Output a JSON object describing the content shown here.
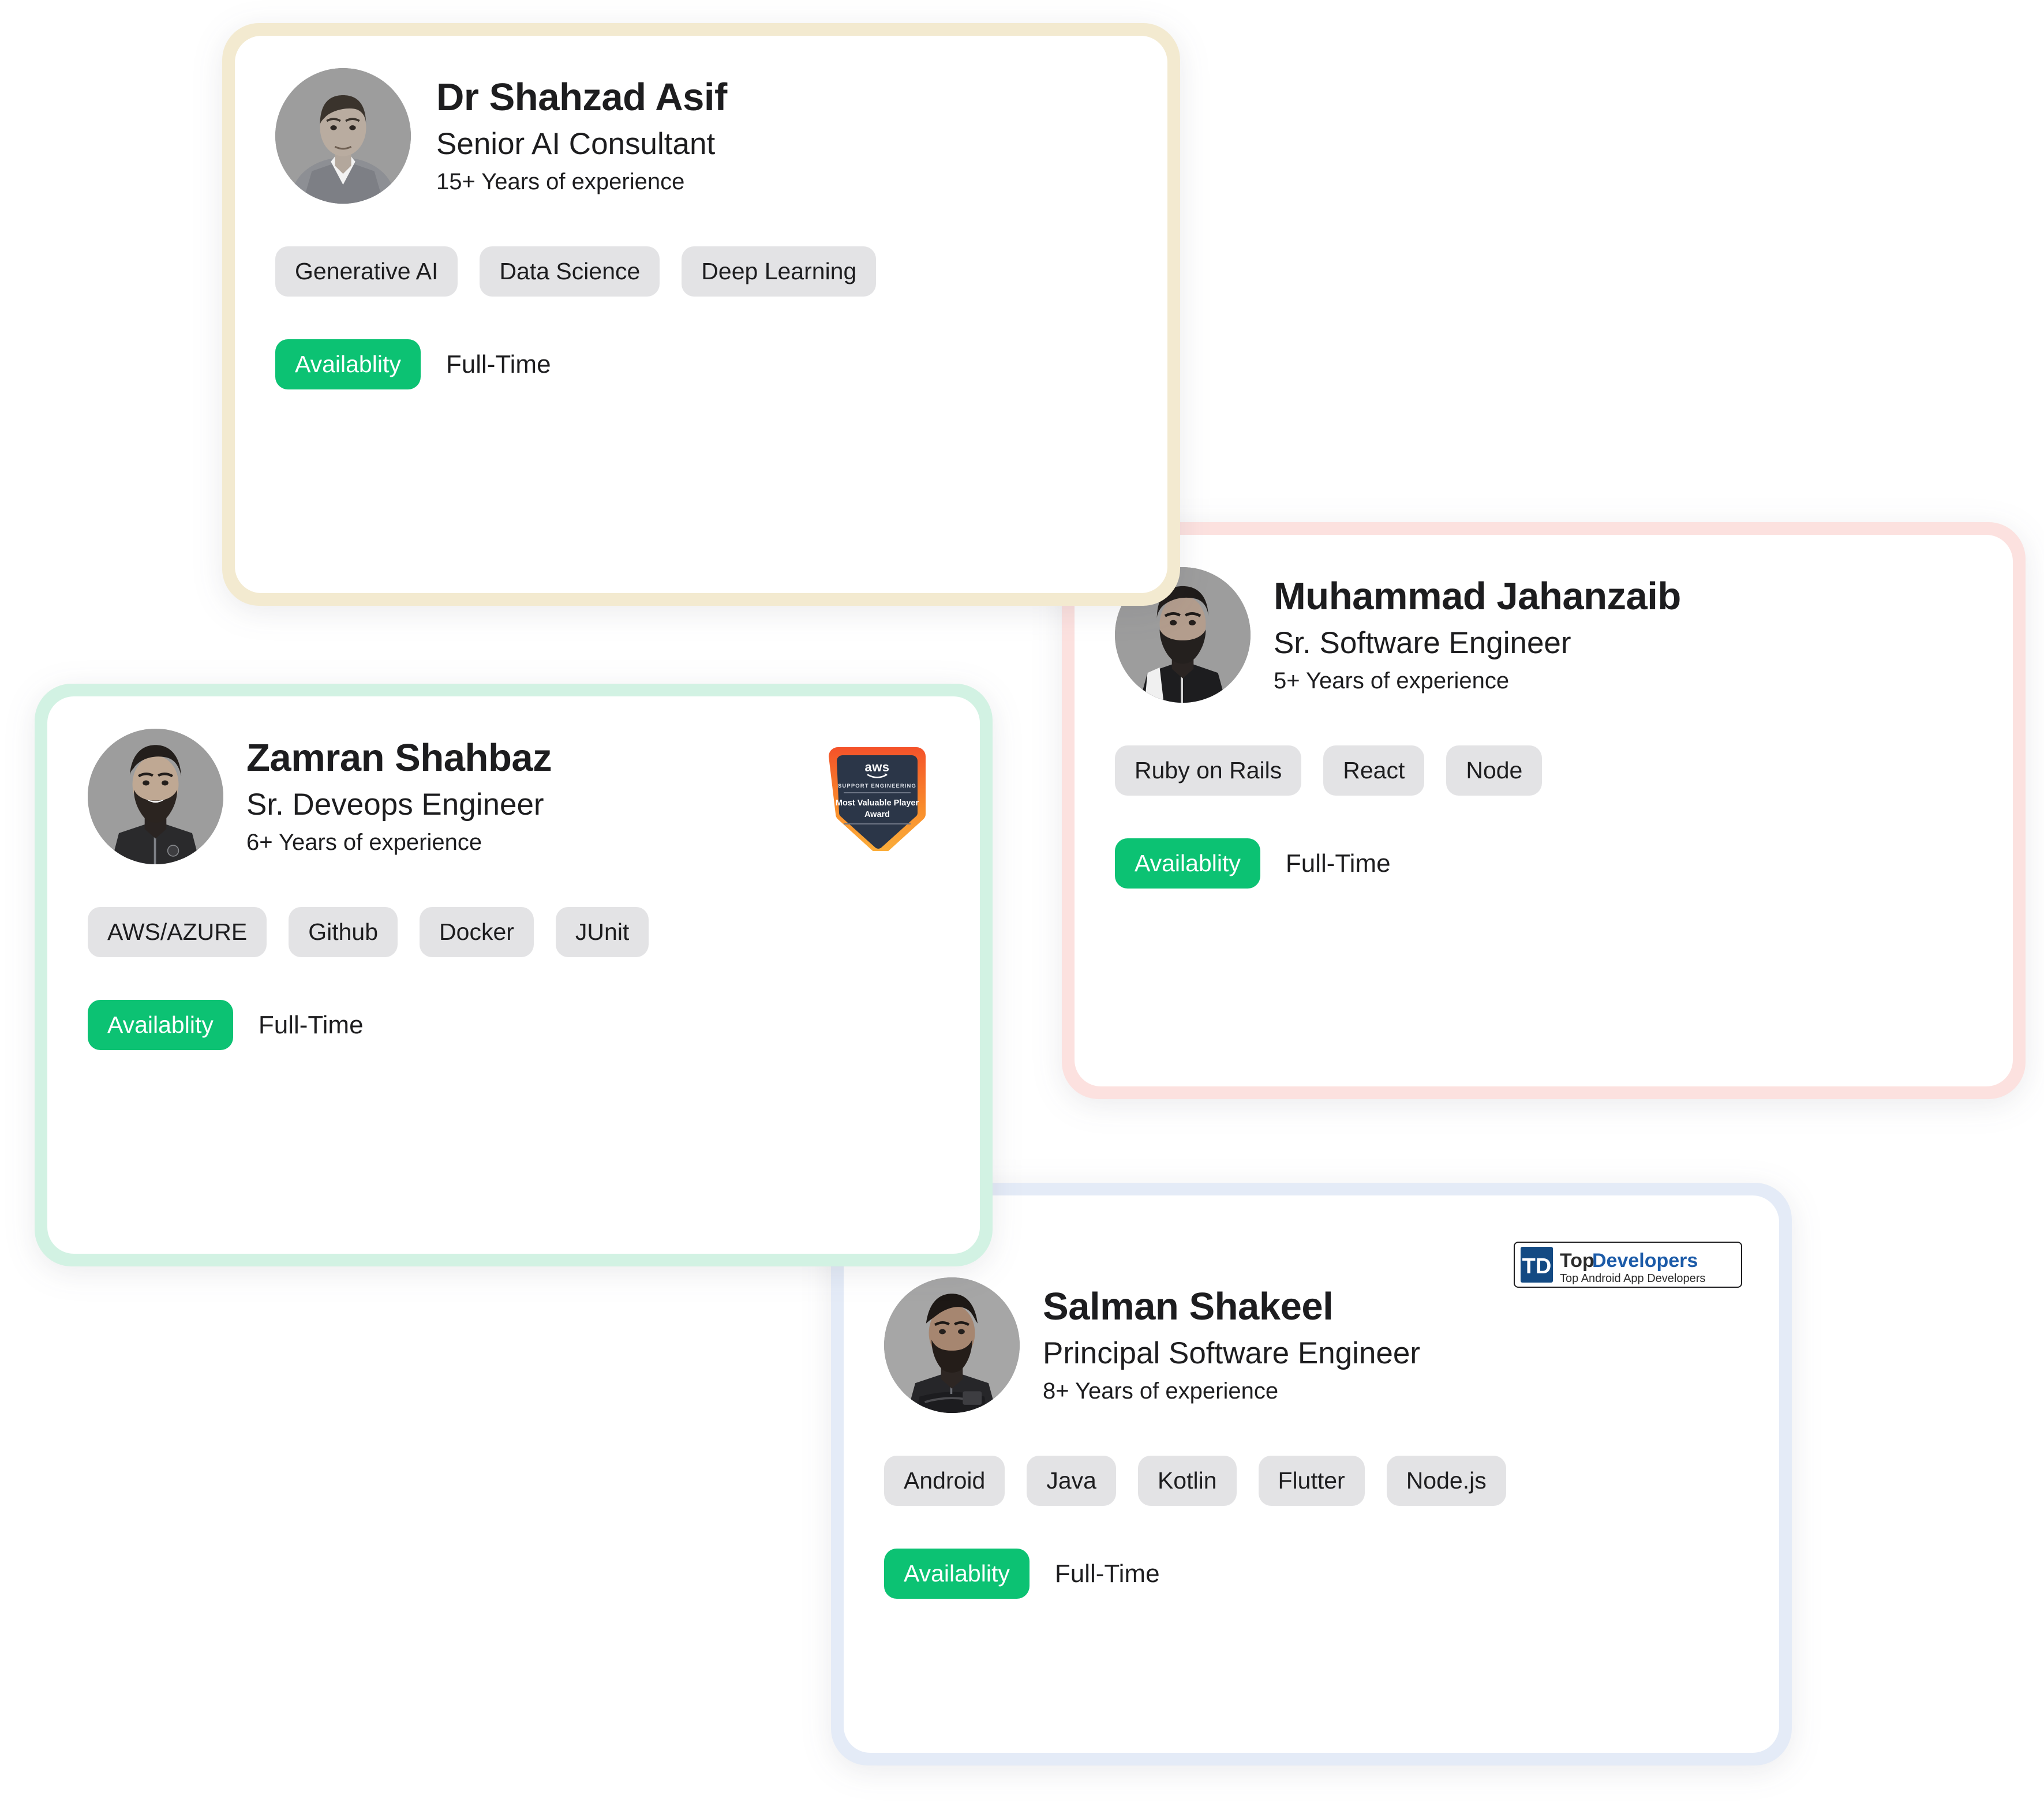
{
  "labels": {
    "availability_badge": "Availablity"
  },
  "colors": {
    "availability_green": "#0cc273",
    "chip_gray": "#e3e3e5",
    "text_dark": "#1d1d1f",
    "card1_accent": "#f3ead0",
    "card2_accent": "#fce1df",
    "card3_accent": "#d2f2e3",
    "card4_accent": "#e4ebf7"
  },
  "cards": [
    {
      "id": "shahzad",
      "name": "Dr Shahzad Asif",
      "role": "Senior AI Consultant",
      "experience": "15+ Years of experience",
      "skills": [
        "Generative AI",
        "Data Science",
        "Deep Learning"
      ],
      "availability_label": "Availablity",
      "availability_value": "Full-Time",
      "accent": "#f3ead0",
      "badge": null
    },
    {
      "id": "jahanzaib",
      "name": "Muhammad Jahanzaib",
      "role": "Sr. Software Engineer",
      "experience": "5+ Years of experience",
      "skills": [
        "Ruby on Rails",
        "React",
        "Node"
      ],
      "availability_label": "Availablity",
      "availability_value": "Full-Time",
      "accent": "#fce1df",
      "badge": null
    },
    {
      "id": "zamran",
      "name": "Zamran Shahbaz",
      "role": "Sr. Deveops Engineer",
      "experience": "6+ Years of experience",
      "skills": [
        "AWS/AZURE",
        "Github",
        "Docker",
        "JUnit"
      ],
      "availability_label": "Availablity",
      "availability_value": "Full-Time",
      "accent": "#d2f2e3",
      "badge": {
        "type": "aws-mvp-award",
        "brand": "aws",
        "category": "SUPPORT ENGINEERING",
        "title_line1": "Most Valuable Player",
        "title_line2": "Award"
      }
    },
    {
      "id": "salman",
      "name": "Salman Shakeel",
      "role": "Principal Software Engineer",
      "experience": "8+ Years of experience",
      "skills": [
        "Android",
        "Java",
        "Kotlin",
        "Flutter",
        "Node.js"
      ],
      "availability_label": "Availablity",
      "availability_value": "Full-Time",
      "accent": "#e4ebf7",
      "badge": {
        "type": "topdevelopers",
        "monogram": "TD",
        "word1": "Top",
        "word2": "Developers",
        "tagline": "Top Android App Developers"
      }
    }
  ]
}
